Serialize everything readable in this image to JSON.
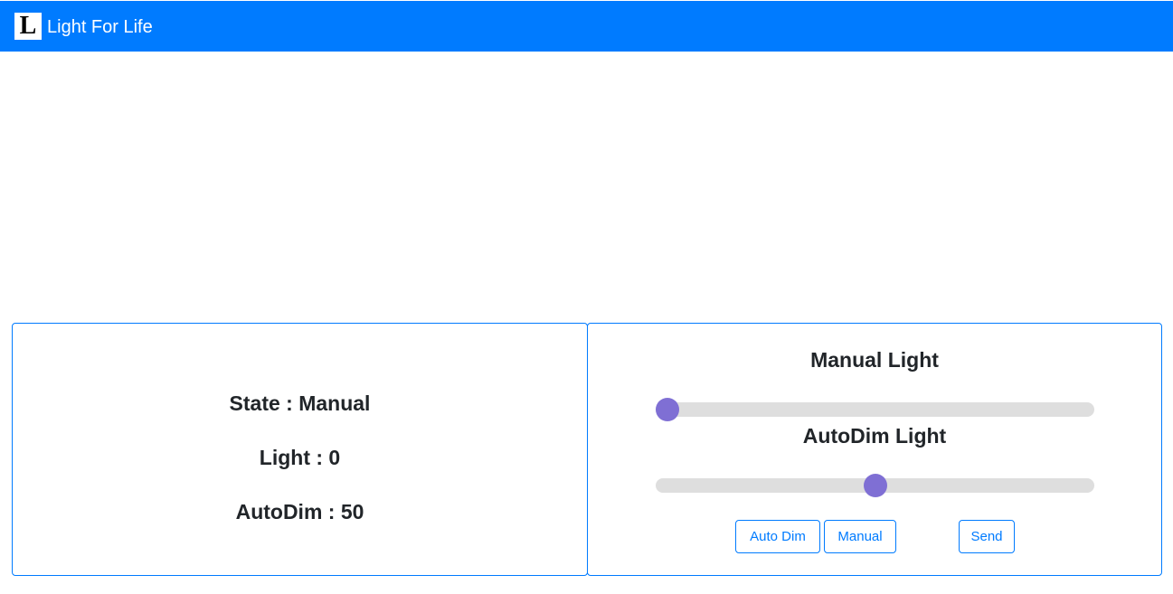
{
  "navbar": {
    "logo_letter": "L",
    "brand": "Light For Life",
    "color": "#007bff"
  },
  "status": {
    "state": "State : Manual",
    "light": "Light : 0",
    "autodim": "AutoDim : 50"
  },
  "controls": {
    "manual_heading": "Manual Light",
    "manual_value": 0,
    "autodim_heading": "AutoDim Light",
    "autodim_value": 50,
    "slider_min": 0,
    "slider_max": 100,
    "thumb_color": "#7f6fd4",
    "buttons": {
      "auto_dim": "Auto Dim",
      "manual": "Manual",
      "send": "Send"
    }
  }
}
